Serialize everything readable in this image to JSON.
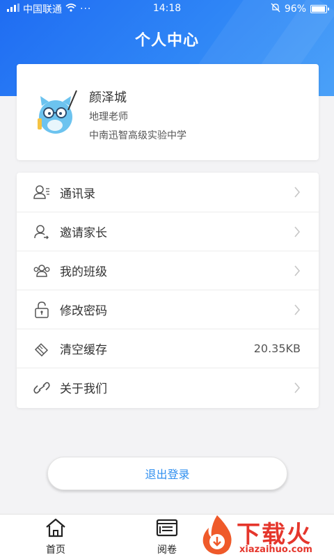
{
  "status_bar": {
    "carrier": "中国联通",
    "time": "14:18",
    "battery": "96%",
    "battery_level": 0.96
  },
  "header": {
    "title": "个人中心"
  },
  "profile": {
    "name": "颜泽城",
    "role": "地理老师",
    "school": "中南迅智高级实验中学"
  },
  "menu": {
    "items": [
      {
        "label": "通讯录",
        "icon": "contacts-icon"
      },
      {
        "label": "邀请家长",
        "icon": "invite-user-icon"
      },
      {
        "label": "我的班级",
        "icon": "group-icon"
      },
      {
        "label": "修改密码",
        "icon": "lock-icon"
      },
      {
        "label": "清空缓存",
        "icon": "eraser-icon",
        "value": "20.35KB"
      },
      {
        "label": "关于我们",
        "icon": "link-icon"
      }
    ]
  },
  "logout": {
    "label": "退出登录"
  },
  "tabbar": {
    "items": [
      {
        "label": "首页",
        "icon": "home-icon"
      },
      {
        "label": "阅卷",
        "icon": "exam-icon"
      }
    ]
  },
  "watermark": {
    "text": "下载火",
    "subtext": "xiazaihuo.com"
  },
  "colors": {
    "accent": "#2f8ff0",
    "header": "#1f6cf2",
    "brand_red": "#e5362c"
  }
}
